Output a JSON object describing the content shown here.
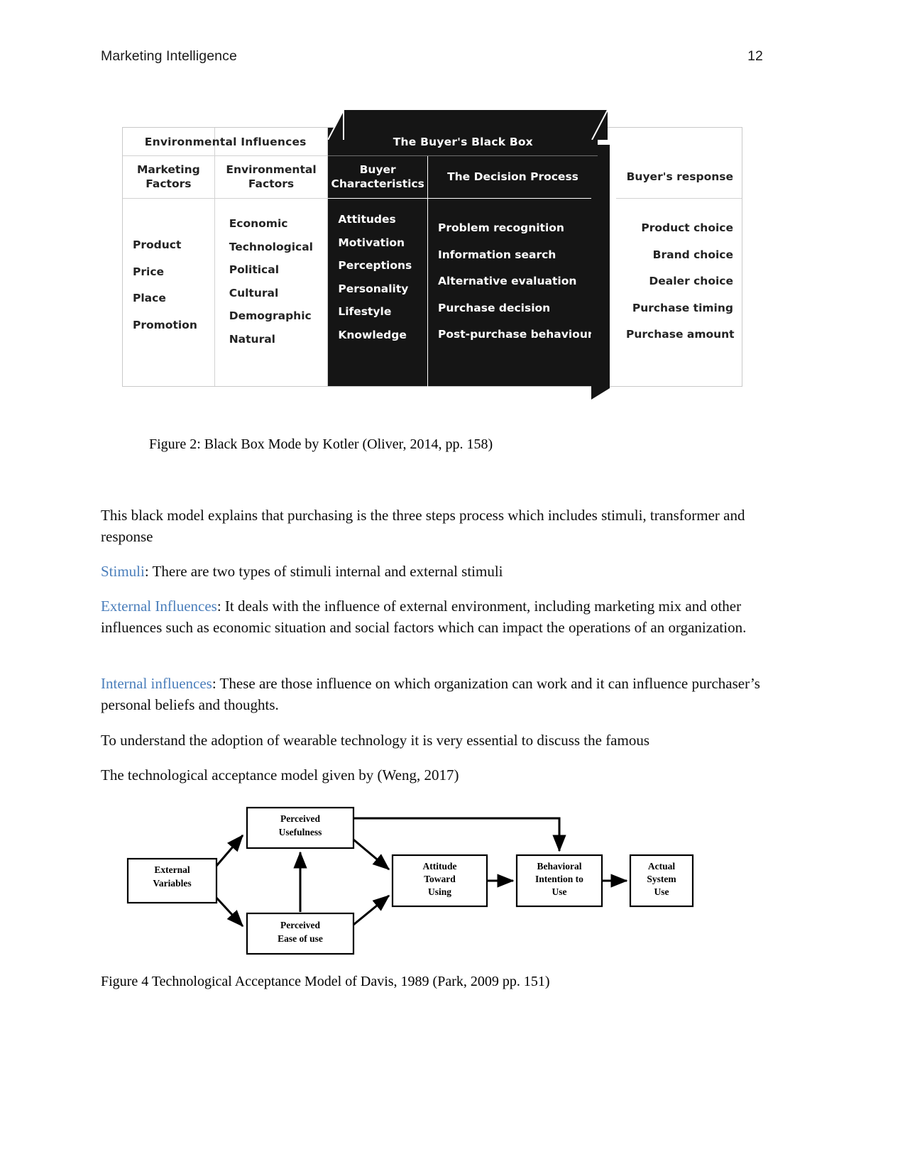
{
  "header": {
    "running_title": "Marketing Intelligence",
    "page_number": "12"
  },
  "figure2": {
    "caption": "Figure 2: Black Box Mode by Kotler (Oliver, 2014, pp. 158)",
    "group_headers": {
      "environmental_influences": "Environmental Influences",
      "buyers_black_box": "The Buyer's Black Box",
      "buyers_response": "Buyer's response"
    },
    "sub_headers": {
      "marketing_factors": "Marketing\nFactors",
      "marketing_factors_l1": "Marketing",
      "marketing_factors_l2": "Factors",
      "environmental_factors_l1": "Environmental",
      "environmental_factors_l2": "Factors",
      "buyer_characteristics_l1": "Buyer",
      "buyer_characteristics_l2": "Characteristics",
      "decision_process": "The Decision Process"
    },
    "columns": {
      "marketing_factors": [
        "Product",
        "Price",
        "Place",
        "Promotion"
      ],
      "environmental_factors": [
        "Economic",
        "Technological",
        "Political",
        "Cultural",
        "Demographic",
        "Natural"
      ],
      "buyer_characteristics": [
        "Attitudes",
        "Motivation",
        "Perceptions",
        "Personality",
        "Lifestyle",
        "Knowledge"
      ],
      "decision_process": [
        "Problem recognition",
        "Information search",
        "Alternative evaluation",
        "Purchase decision",
        "Post-purchase behaviour"
      ],
      "buyers_response": [
        "Product choice",
        "Brand choice",
        "Dealer choice",
        "Purchase timing",
        "Purchase amount"
      ]
    },
    "colors": {
      "black_box_fill": "#151515",
      "black_box_text": "#ffffff",
      "table_border": "#c9c9c9"
    }
  },
  "body": {
    "p1": "This black model explains that purchasing is the three steps process which includes stimuli, transformer and response",
    "p2_lead": "Stimuli",
    "p2_rest": ": There are two types of stimuli internal and external stimuli",
    "p3_lead": "External Influences",
    "p3_rest": ": It deals with the influence of external environment, including marketing mix and other influences such as economic situation and social factors which can impact the operations of an organization.",
    "p4_lead": "Internal influences",
    "p4_rest": ": These are those influence on which organization can work and it can influence purchaser’s personal beliefs and thoughts.",
    "p5": "To understand the adoption of wearable technology it is very essential to discuss the famous",
    "p6": "The technological acceptance model given by (Weng, 2017)",
    "lead_color": "#4a7ebb"
  },
  "figure4": {
    "caption": "Figure 4 Technological Acceptance Model of Davis, 1989 (Park, 2009 pp. 151)",
    "nodes": {
      "external_variables_l1": "External",
      "external_variables_l2": "Variables",
      "perceived_usefulness_l1": "Perceived",
      "perceived_usefulness_l2": "Usefulness",
      "perceived_ease_l1": "Perceived",
      "perceived_ease_l2": "Ease of use",
      "attitude_l1": "Attitude",
      "attitude_l2": "Toward",
      "attitude_l3": "Using",
      "behavioral_l1": "Behavioral",
      "behavioral_l2": "Intention to",
      "behavioral_l3": "Use",
      "actual_l1": "Actual",
      "actual_l2": "System",
      "actual_l3": "Use"
    }
  }
}
